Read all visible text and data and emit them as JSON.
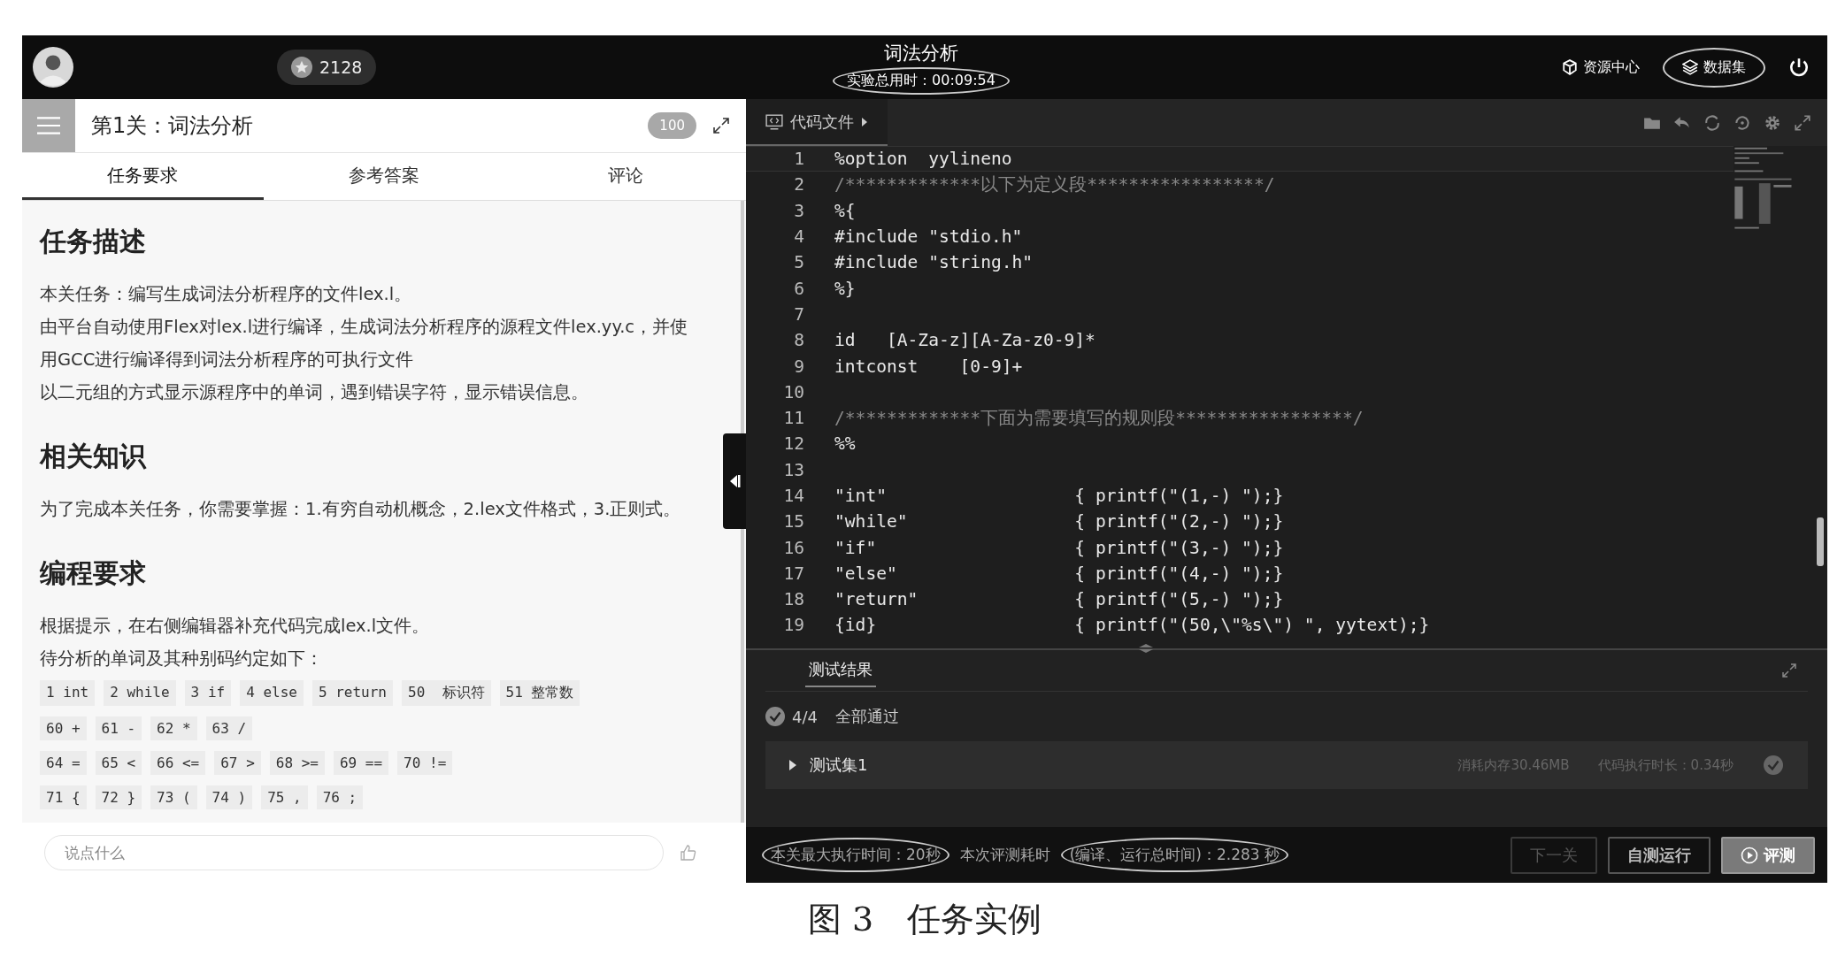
{
  "top_bar": {
    "points": "2128",
    "title": "词法分析",
    "timer": {
      "text": "实验总用时：00:09:54",
      "circled": true
    },
    "links": [
      {
        "label": "资源中心",
        "kind": "cube",
        "circled": false
      },
      {
        "label": "数据集",
        "kind": "layers",
        "circled": true
      }
    ]
  },
  "task_panel": {
    "title": "第1关：词法分析",
    "score": "100",
    "tabs": [
      {
        "label": "任务要求",
        "selected": true
      },
      {
        "label": "参考答案",
        "selected": false
      },
      {
        "label": "评论",
        "selected": false
      }
    ],
    "sections": [
      {
        "heading": "任务描述",
        "paragraphs": [
          "本关任务：编写生成词法分析程序的文件lex.l。",
          "由平台自动使用Flex对lex.l进行编译，生成词法分析程序的源程文件lex.yy.c，并使用GCC进行编译得到词法分析程序的可执行文件",
          "以二元组的方式显示源程序中的单词，遇到错误字符，显示错误信息。"
        ]
      },
      {
        "heading": "相关知识",
        "paragraphs": [
          "为了完成本关任务，你需要掌握：1.有穷自动机概念，2.lex文件格式，3.正则式。"
        ]
      },
      {
        "heading": "编程要求",
        "paragraphs": [
          "根据提示，在右侧编辑器补充代码完成lex.l文件。",
          "待分析的单词及其种别码约定如下："
        ]
      }
    ],
    "token_table": [
      [
        "1 int",
        "2 while",
        "3 if",
        "4 else",
        "5 return",
        "50  标识符",
        "51 整常数"
      ],
      [
        "60 +",
        "61 -",
        "62 *",
        "63 /"
      ],
      [
        "64 =",
        "65 <",
        "66 <=",
        "67 >",
        "68 >=",
        "69 ==",
        "70 !="
      ],
      [
        "71 {",
        "72 }",
        "73 (",
        "74 )",
        "75 ,",
        "76 ;"
      ]
    ],
    "comment": {
      "placeholder": "说点什么"
    }
  },
  "editor": {
    "file_tab": "代码文件",
    "lines": [
      {
        "number": "1",
        "text": "%option  yylineno",
        "kind": "code",
        "current": true
      },
      {
        "number": "2",
        "text": "/*************以下为定义段*****************/",
        "kind": "comment",
        "current": false
      },
      {
        "number": "3",
        "text": "%{",
        "kind": "code",
        "current": false
      },
      {
        "number": "4",
        "text": "#include \"stdio.h\"",
        "kind": "code",
        "current": false
      },
      {
        "number": "5",
        "text": "#include \"string.h\"",
        "kind": "code",
        "current": false
      },
      {
        "number": "6",
        "text": "%}",
        "kind": "code",
        "current": false
      },
      {
        "number": "7",
        "current": false
      },
      {
        "number": "8",
        "text": "id   [A-Za-z][A-Za-z0-9]*",
        "kind": "code",
        "current": false
      },
      {
        "number": "9",
        "text": "intconst    [0-9]+",
        "kind": "code",
        "current": false
      },
      {
        "number": "10",
        "current": false
      },
      {
        "number": "11",
        "text": "/*************下面为需要填写的规则段*****************/",
        "kind": "comment",
        "current": false
      },
      {
        "number": "12",
        "text": "%%",
        "kind": "code",
        "current": false
      },
      {
        "number": "13",
        "current": false
      },
      {
        "number": "14",
        "text": "\"int\"                  { printf(\"(1,-) \");}",
        "kind": "code",
        "current": false
      },
      {
        "number": "15",
        "text": "\"while\"                { printf(\"(2,-) \");}",
        "kind": "code",
        "current": false
      },
      {
        "number": "16",
        "text": "\"if\"                   { printf(\"(3,-) \");}",
        "kind": "code",
        "current": false
      },
      {
        "number": "17",
        "text": "\"else\"                 { printf(\"(4,-) \");}",
        "kind": "code",
        "current": false
      },
      {
        "number": "18",
        "text": "\"return\"               { printf(\"(5,-) \");}",
        "kind": "code",
        "current": false
      },
      {
        "number": "19",
        "text": "{id}                   { printf(\"(50,\\\"%s\\\") \", yytext);}",
        "kind": "code",
        "current": false
      }
    ]
  },
  "test_results": {
    "tab": "测试结果",
    "summary": "4/4",
    "summary_label": "全部通过",
    "sets": [
      {
        "name": "测试集1",
        "memory": "消耗内存30.46MB",
        "duration": "代码执行时长：0.34秒",
        "passed": true,
        "expanded": false
      }
    ]
  },
  "status": [
    {
      "text": "本关最大执行时间：20秒",
      "circled": true
    },
    {
      "text": "本次评测耗时",
      "circled": false
    },
    {
      "text": "(编译、运行总时间)：2.283 秒",
      "circled": true
    }
  ],
  "buttons": [
    {
      "label": "下一关",
      "kind": "secondary",
      "disabled": true
    },
    {
      "label": "自测运行",
      "kind": "secondary",
      "disabled": false
    },
    {
      "label": "评测",
      "kind": "primary",
      "disabled": false
    }
  ],
  "caption": "图 3　任务实例"
}
